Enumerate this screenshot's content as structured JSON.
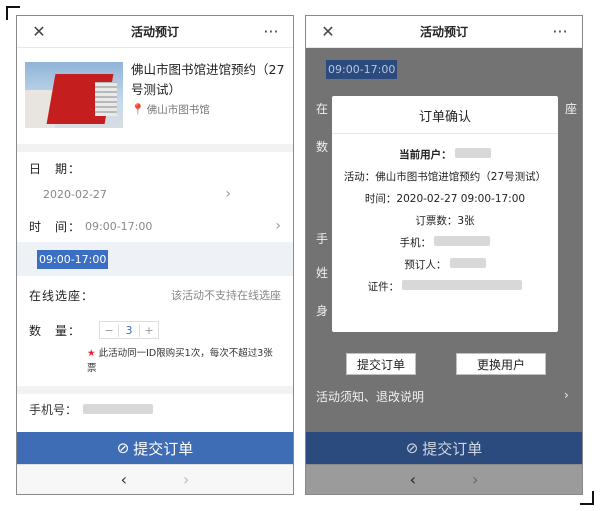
{
  "left": {
    "header": {
      "close_icon": "close-icon",
      "title": "活动预订",
      "more": "···"
    },
    "event": {
      "title": "佛山市图书馆进馆预约（27号测试）",
      "location": "佛山市图书馆"
    },
    "date": {
      "label": "日　期：",
      "value": "2020-02-27"
    },
    "time": {
      "label": "时　间：",
      "value": "09:00-17:00"
    },
    "slot": "09:00-17:00",
    "seat": {
      "label": "在线选座：",
      "value": "该活动不支持在线选座"
    },
    "qty": {
      "label": "数　量：",
      "minus": "−",
      "value": "3",
      "plus": "+"
    },
    "note": "此活动同一ID限购买1次，每次不超过3张票",
    "phone": {
      "label": "手机号："
    },
    "submit": "提交订单",
    "nav": {
      "back": "‹",
      "forward": "›"
    }
  },
  "right": {
    "header": {
      "title": "活动预订",
      "more": "···"
    },
    "slot": "09:00-17:00",
    "bg_labels": [
      "在",
      "数",
      "手",
      "姓",
      "身"
    ],
    "bg_seat_tail": "座",
    "bg_notice": "活动须知、退改说明",
    "modal": {
      "title": "订单确认",
      "user_label": "当前用户：",
      "activity_label": "活动：",
      "activity": "佛山市图书馆进馆预约（27号测试）",
      "time_label": "时间：",
      "time": "2020-02-27 09:00-17:00",
      "tickets": "订票数：3张",
      "phone_label": "手机：",
      "booker_label": "预订人：",
      "id_label": "证件："
    },
    "buttons": {
      "submit": "提交订单",
      "change_user": "更换用户"
    },
    "submit": "提交订单",
    "nav": {
      "back": "‹",
      "forward": "›"
    }
  }
}
